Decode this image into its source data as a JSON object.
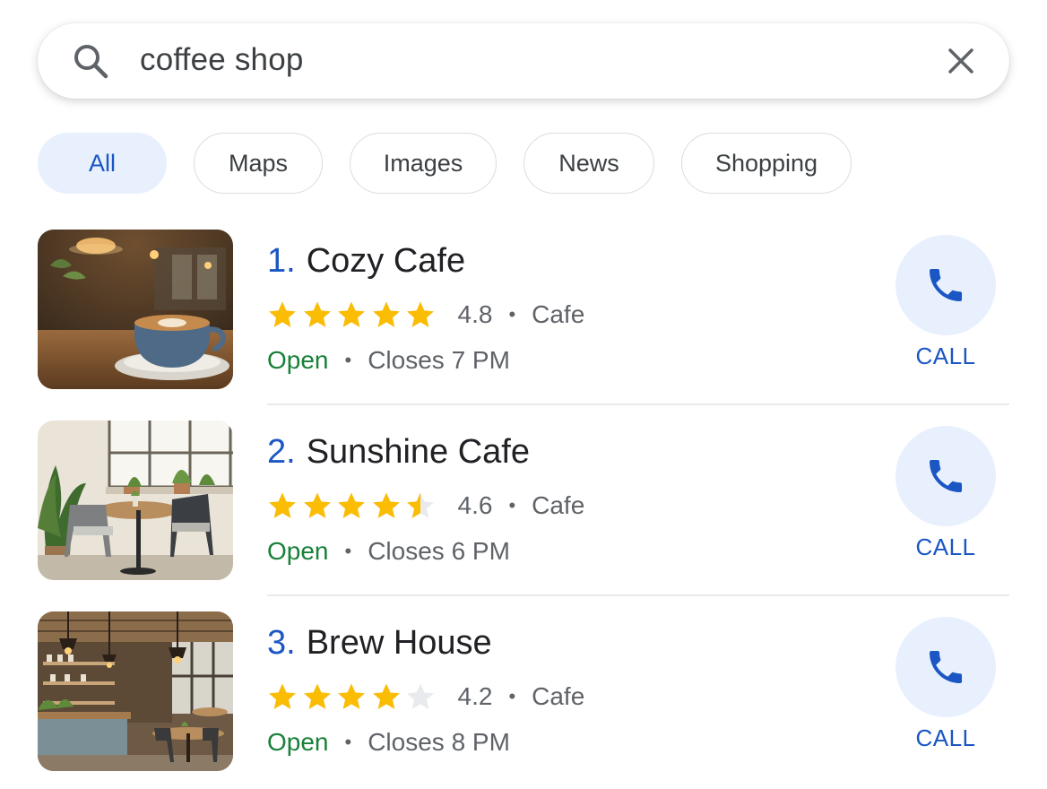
{
  "search": {
    "query": "coffee shop"
  },
  "filters": [
    {
      "label": "All",
      "active": true
    },
    {
      "label": "Maps",
      "active": false
    },
    {
      "label": "Images",
      "active": false
    },
    {
      "label": "News",
      "active": false
    },
    {
      "label": "Shopping",
      "active": false
    }
  ],
  "results": [
    {
      "rank": "1.",
      "name": "Cozy Cafe",
      "rating": "4.8",
      "stars_filled": 5,
      "category": "Cafe",
      "status": "Open",
      "hours": "Closes 7 PM",
      "call_label": "CALL",
      "thumbnail": "latte-cup-photo"
    },
    {
      "rank": "2.",
      "name": "Sunshine Cafe",
      "rating": "4.6",
      "stars_filled": 4.5,
      "category": "Cafe",
      "status": "Open",
      "hours": "Closes 6 PM",
      "call_label": "CALL",
      "thumbnail": "sunny-cafe-interior-photo"
    },
    {
      "rank": "3.",
      "name": "Brew House",
      "rating": "4.2",
      "stars_filled": 4,
      "category": "Cafe",
      "status": "Open",
      "hours": "Closes 8 PM",
      "call_label": "CALL",
      "thumbnail": "brew-house-interior-photo"
    }
  ],
  "colors": {
    "accent": "#1a56c4",
    "star": "#fbbc04",
    "star_empty": "#e8eaed",
    "open": "#188038",
    "chip_active_bg": "#e8f0fe"
  },
  "icons": {
    "search": "search-icon",
    "clear": "close-icon",
    "call": "phone-icon",
    "rating": "star-icon"
  }
}
